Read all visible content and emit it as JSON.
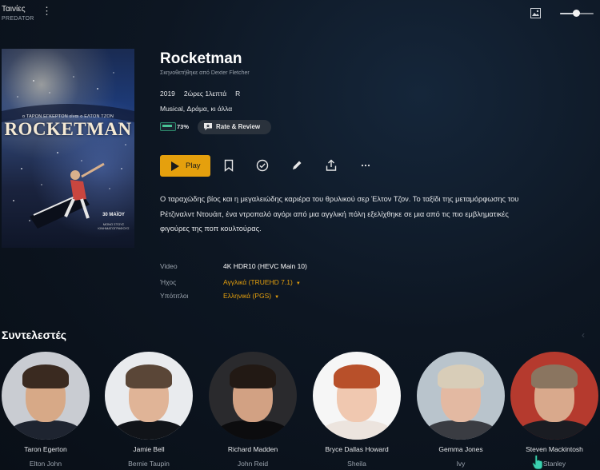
{
  "topbar": {
    "title": "Ταινίες",
    "subtitle": "PREDATOR",
    "more_icon": "more-vertical-icon",
    "image_icon": "image-icon",
    "slider_level": 0.5
  },
  "poster": {
    "top_line": "ο ΤΑΡΟΝ ΕΓΚΕΡΤΟΝ είναι ο ΕΛΤΟΝ ΤΖΟΝ",
    "title": "ROCKETMAN",
    "date": "30 ΜΑΪΟΥ",
    "date_sub": "ΜΟΝΟ ΣΤΟΥΣ ΚΙΝΗΜΑΤΟΓΡΑΦΟΥΣ"
  },
  "movie": {
    "title": "Rocketman",
    "director": "Σκηνοθετήθηκε από Dexter Fletcher",
    "year": "2019",
    "duration": "2ώρες 1λεπτά",
    "rating": "R",
    "genres": "Musical, Δράμα, κι άλλα",
    "score": "73%",
    "rate_label": "Rate & Review",
    "description": "Ο ταραχώδης βίος και η μεγαλειώδης καριέρα του θρυλικού σερ Έλτον Τζον. Το ταξίδι της μεταμόρφωσης του Ρέτζιναλντ Ντουάιτ, ένα ντροπαλό αγόρι από μια αγγλική πόλη εξελίχθηκε σε μια από τις πιο εμβληματικές φιγούρες της ποπ κουλτούρας."
  },
  "actions": {
    "play_label": "Play",
    "icons": [
      "bookmark-icon",
      "check-circle-icon",
      "edit-icon",
      "share-icon",
      "more-horizontal-icon"
    ]
  },
  "specs": {
    "video_label": "Video",
    "video_value": "4K HDR10 (HEVC Main 10)",
    "audio_label": "Ήχος",
    "audio_value": "Αγγλικά (TRUEHD 7.1)",
    "subs_label": "Υπότιτλοι",
    "subs_value": "Ελληνικά (PGS)"
  },
  "cast": {
    "heading": "Συντελεστές",
    "people": [
      {
        "name": "Taron Egerton",
        "role": "Elton John"
      },
      {
        "name": "Jamie Bell",
        "role": "Bernie Taupin"
      },
      {
        "name": "Richard Madden",
        "role": "John Reid"
      },
      {
        "name": "Bryce Dallas Howard",
        "role": "Sheila"
      },
      {
        "name": "Gemma Jones",
        "role": "Ivy"
      },
      {
        "name": "Steven Mackintosh",
        "role": "Stanley"
      }
    ]
  },
  "colors": {
    "accent": "#e5a00d",
    "background": "#0d1622",
    "muted_text": "#9aa3ad"
  }
}
